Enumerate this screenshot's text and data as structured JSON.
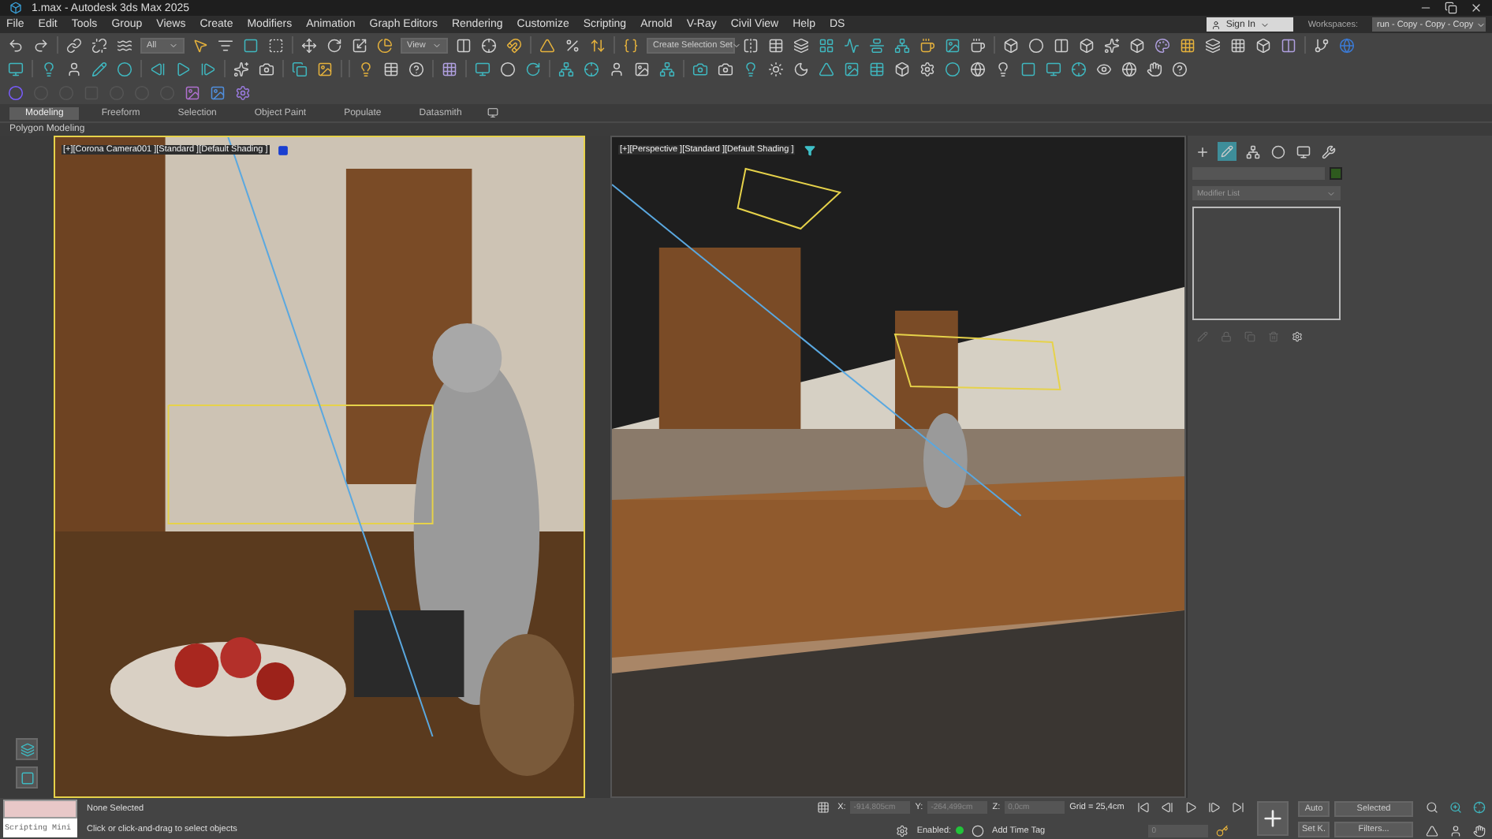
{
  "window": {
    "title": "1.max - Autodesk 3ds Max 2025"
  },
  "menu": [
    "File",
    "Edit",
    "Tools",
    "Group",
    "Views",
    "Create",
    "Modifiers",
    "Animation",
    "Graph Editors",
    "Rendering",
    "Customize",
    "Scripting",
    "Arnold",
    "V-Ray",
    "Civil View",
    "Help",
    "DS"
  ],
  "sign_in": "Sign In",
  "workspaces": {
    "label": "Workspaces:",
    "value": "run - Copy - Copy - Copy"
  },
  "toolbar": {
    "selection_filter": "All",
    "reference_coord": "View",
    "selection_set": "Create Selection Set"
  },
  "ribbon": {
    "tabs": [
      {
        "label": "Modeling",
        "selected": true
      },
      {
        "label": "Freeform",
        "selected": false
      },
      {
        "label": "Selection",
        "selected": false
      },
      {
        "label": "Object Paint",
        "selected": false
      },
      {
        "label": "Populate",
        "selected": false
      },
      {
        "label": "Datasmith",
        "selected": false
      }
    ],
    "panel": "Polygon Modeling"
  },
  "viewports": [
    {
      "label": "[+][Corona Camera001 ][Standard ][Default Shading ]",
      "active": true
    },
    {
      "label": "[+][Perspective ][Standard ][Default Shading ]",
      "active": false
    }
  ],
  "command_panel": {
    "modifier_list": "Modifier List"
  },
  "status": {
    "scripting": "Scripting Mini",
    "selection": "None Selected",
    "prompt": "Click or click-and-drag to select objects",
    "x_label": "X:",
    "x": "-914,805cm",
    "y_label": "Y:",
    "y": "-264,499cm",
    "z_label": "Z:",
    "z": "0,0cm",
    "grid": "Grid = 25,4cm",
    "enabled": "Enabled:",
    "time_tag": "Add Time Tag",
    "frame": "0",
    "auto": "Auto",
    "set_key": "Set K.",
    "key_filter": "Selected",
    "filters": "Filters..."
  }
}
